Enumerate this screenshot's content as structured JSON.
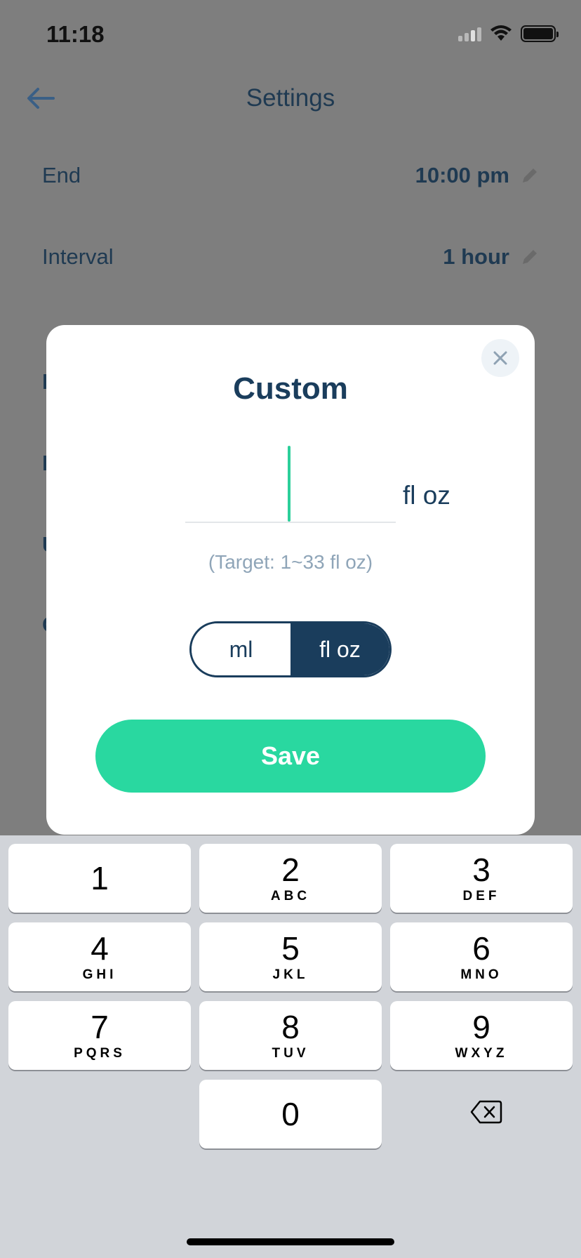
{
  "status_bar": {
    "time": "11:18"
  },
  "nav": {
    "title": "Settings"
  },
  "settings": {
    "rows": [
      {
        "label": "End",
        "value": "10:00 pm"
      },
      {
        "label": "Interval",
        "value": "1 hour"
      }
    ],
    "peek_letters": [
      "I",
      "I",
      "U",
      "C"
    ]
  },
  "modal": {
    "title": "Custom",
    "input_value": "",
    "unit_suffix": "fl oz",
    "target_hint": "(Target: 1~33 fl oz)",
    "unit_options": [
      "ml",
      "fl oz"
    ],
    "selected_unit": "fl oz",
    "save_label": "Save"
  },
  "keyboard": {
    "keys": [
      {
        "num": "1",
        "letters": ""
      },
      {
        "num": "2",
        "letters": "ABC"
      },
      {
        "num": "3",
        "letters": "DEF"
      },
      {
        "num": "4",
        "letters": "GHI"
      },
      {
        "num": "5",
        "letters": "JKL"
      },
      {
        "num": "6",
        "letters": "MNO"
      },
      {
        "num": "7",
        "letters": "PQRS"
      },
      {
        "num": "8",
        "letters": "TUV"
      },
      {
        "num": "9",
        "letters": "WXYZ"
      },
      {
        "num": "0",
        "letters": ""
      }
    ]
  },
  "colors": {
    "accent": "#29d8a0",
    "navy": "#1a3d5c",
    "overlay": "#7e7e7e"
  }
}
